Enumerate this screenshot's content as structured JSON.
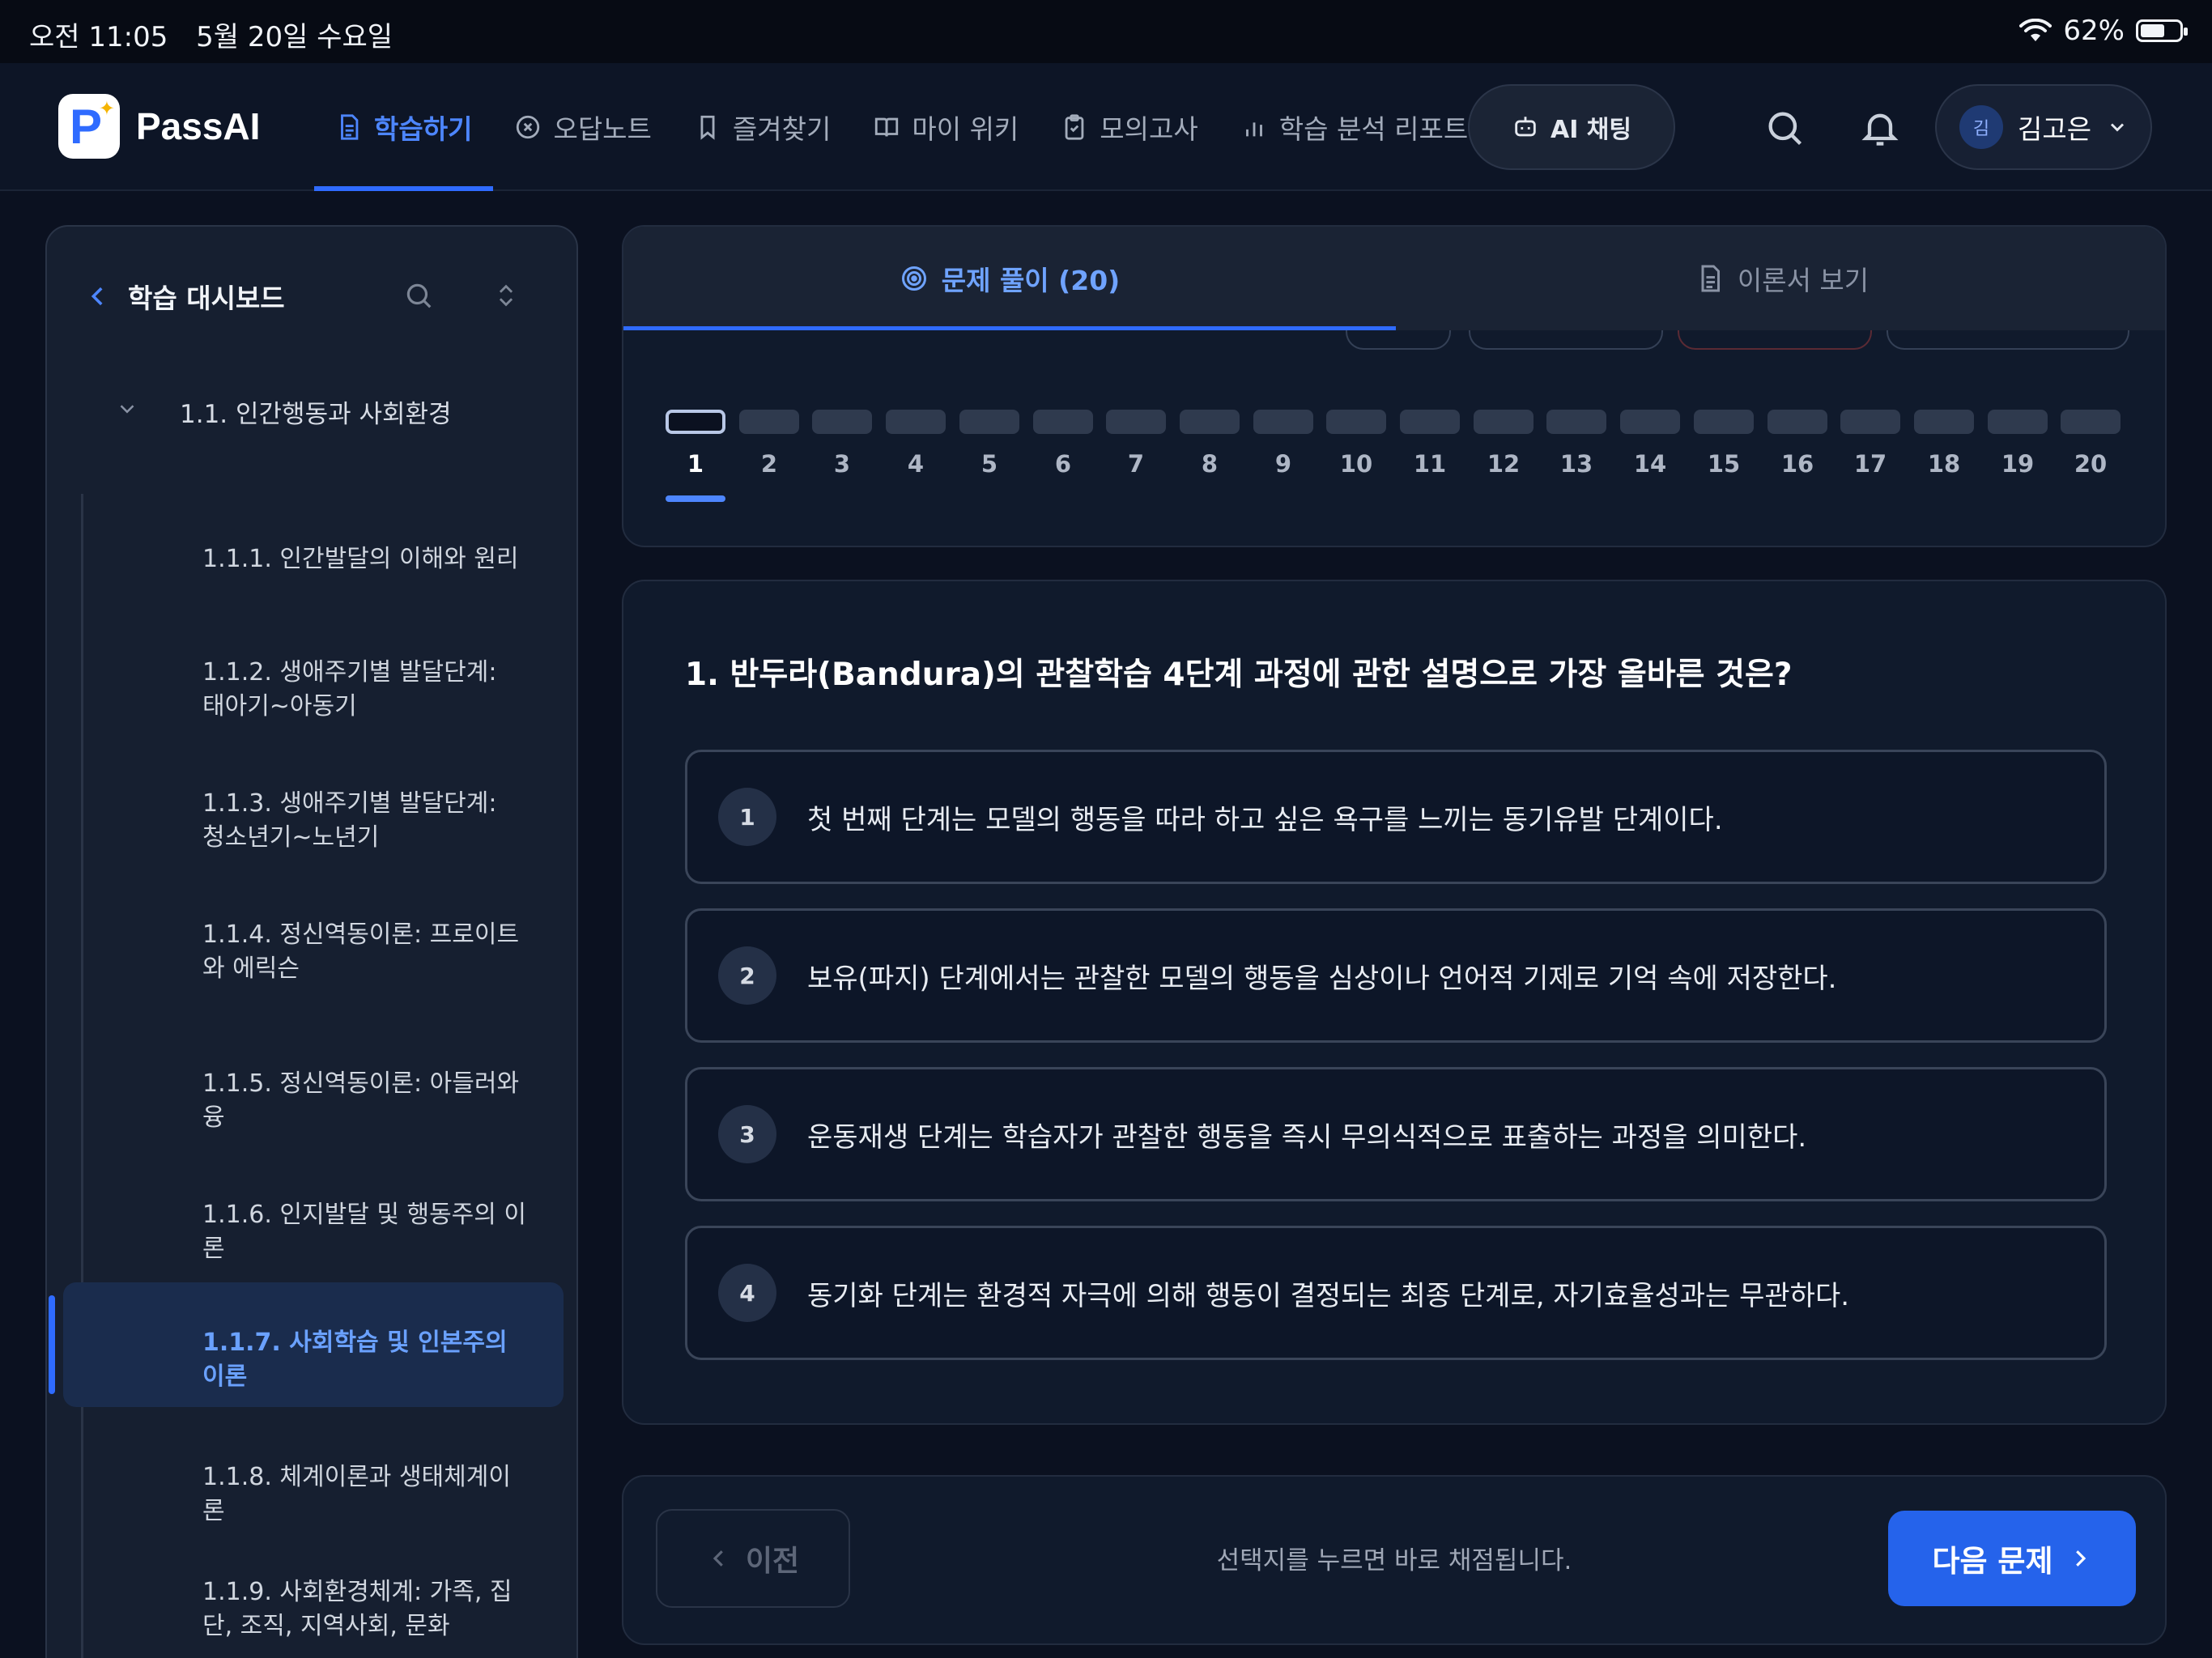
{
  "status": {
    "time": "오전 11:05",
    "date": "5월 20일 수요일",
    "battery": "62%",
    "battery_level": 0.62
  },
  "app": {
    "name": "PassAI"
  },
  "nav": {
    "tabs": [
      {
        "label": "학습하기",
        "icon": "document-icon",
        "active": true
      },
      {
        "label": "오답노트",
        "icon": "x-circle-icon"
      },
      {
        "label": "즐겨찾기",
        "icon": "bookmark-icon"
      },
      {
        "label": "마이 위키",
        "icon": "book-icon"
      },
      {
        "label": "모의고사",
        "icon": "clipboard-icon"
      },
      {
        "label": "학습 분석 리포트",
        "icon": "bar-chart-icon"
      }
    ],
    "ai_chat": "AI 채팅"
  },
  "user": {
    "initial": "김",
    "name": "김고은"
  },
  "sidebar": {
    "title": "학습 대시보드",
    "section": "1.1. 인간행동과 사회환경",
    "items": [
      {
        "label": "1.1.1. 인간발달의 이해와 원리"
      },
      {
        "label": "1.1.2. 생애주기별 발달단계: 태아기~아동기"
      },
      {
        "label": "1.1.3. 생애주기별 발달단계: 청소년기~노년기"
      },
      {
        "label": "1.1.4. 정신역동이론: 프로이트와 에릭슨"
      },
      {
        "label": "1.1.5. 정신역동이론: 아들러와 융"
      },
      {
        "label": "1.1.6. 인지발달 및 행동주의 이론"
      },
      {
        "label": "1.1.7. 사회학습 및 인본주의 이론",
        "active": true
      },
      {
        "label": "1.1.8. 체계이론과 생태체계이론"
      },
      {
        "label": "1.1.9. 사회환경체계: 가족, 집단, 조직, 지역사회, 문화"
      }
    ]
  },
  "tabs": {
    "problems": "문제 풀이 (20)",
    "theory": "이론서 보기"
  },
  "questions": {
    "current": 1,
    "numbers": [
      "1",
      "2",
      "3",
      "4",
      "5",
      "6",
      "7",
      "8",
      "9",
      "10",
      "11",
      "12",
      "13",
      "14",
      "15",
      "16",
      "17",
      "18",
      "19",
      "20"
    ]
  },
  "question": {
    "title": "1. 반두라(Bandura)의 관찰학습 4단계 과정에 관한 설명으로 가장 올바른 것은?",
    "options": [
      {
        "num": "1",
        "text": "첫 번째 단계는 모델의 행동을 따라 하고 싶은 욕구를 느끼는 동기유발 단계이다."
      },
      {
        "num": "2",
        "text": "보유(파지) 단계에서는 관찰한 모델의 행동을 심상이나 언어적 기제로 기억 속에 저장한다."
      },
      {
        "num": "3",
        "text": "운동재생 단계는 학습자가 관찰한 행동을 즉시 무의식적으로 표출하는 과정을 의미한다."
      },
      {
        "num": "4",
        "text": "동기화 단계는 환경적 자극에 의해 행동이 결정되는 최종 단계로, 자기효율성과는 무관하다."
      }
    ]
  },
  "footer": {
    "prev": "이전",
    "hint": "선택지를 누르면 바로 채점됩니다.",
    "next": "다음 문제"
  },
  "colors": {
    "accent": "#2f6bff",
    "background": "#0b1120",
    "panel": "#101a2c"
  }
}
